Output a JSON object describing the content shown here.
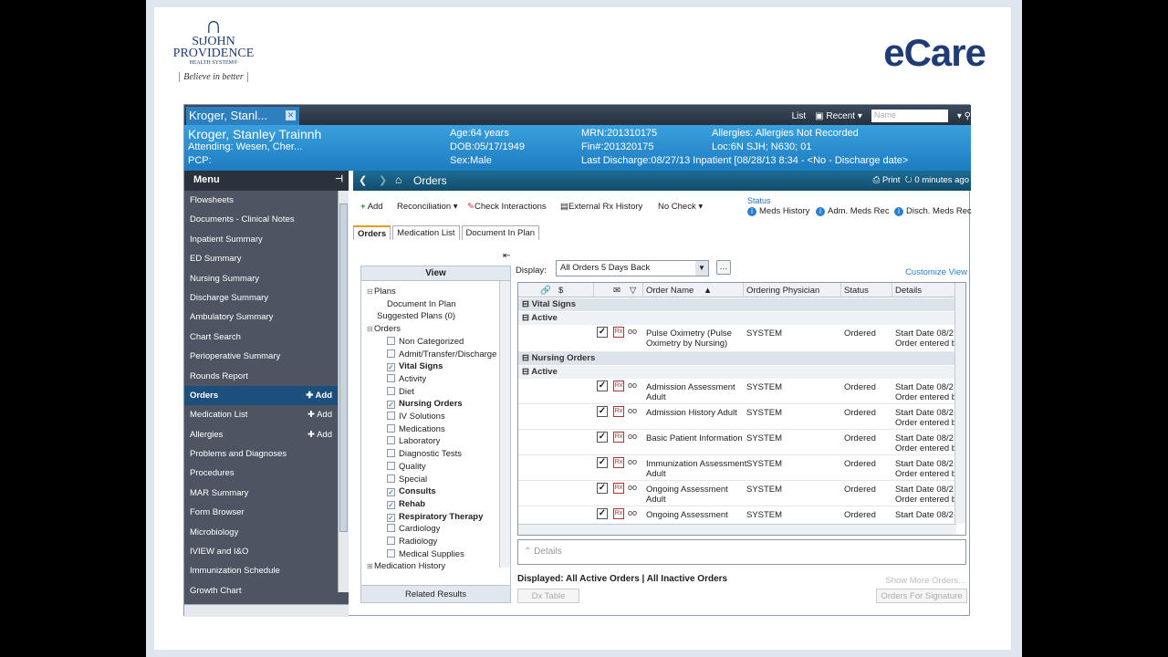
{
  "branding": {
    "logo_line1": "StJOHN",
    "logo_line2": "PROVIDENCE",
    "logo_line3": "HEALTH SYSTEM®",
    "tagline": "Believe in better",
    "product": "eCare"
  },
  "topbar": {
    "patient_tab": "Kroger, Stanl...",
    "list_label": "List",
    "recent_label": "Recent",
    "name_placeholder": "Name"
  },
  "banner": {
    "patient_name": "Kroger, Stanley Trainnh",
    "attending": "Attending: Wesen, Cher...",
    "pcp": "PCP:",
    "age": "Age:64 years",
    "dob": "DOB:05/17/1949",
    "sex": "Sex:Male",
    "mrn": "MRN:201310175",
    "fin": "Fin#:201320175",
    "last_discharge": "Last Discharge:08/27/13 Inpatient [08/28/13 8:34 - <No - Discharge date>",
    "allergies": "Allergies: Allergies Not Recorded",
    "location": "Loc:6N SJH; N630; 01"
  },
  "menu": {
    "title": "Menu",
    "items": [
      {
        "label": "Flowsheets",
        "add": ""
      },
      {
        "label": "Documents - Clinical Notes",
        "add": ""
      },
      {
        "label": "Inpatient Summary",
        "add": ""
      },
      {
        "label": "ED Summary",
        "add": ""
      },
      {
        "label": "Nursing Summary",
        "add": ""
      },
      {
        "label": "Discharge Summary",
        "add": ""
      },
      {
        "label": "Ambulatory Summary",
        "add": ""
      },
      {
        "label": "Chart Search",
        "add": ""
      },
      {
        "label": "Perioperative Summary",
        "add": ""
      },
      {
        "label": "Rounds Report",
        "add": ""
      },
      {
        "label": "Orders",
        "add": "Add"
      },
      {
        "label": "Medication List",
        "add": "Add"
      },
      {
        "label": "Allergies",
        "add": "Add"
      },
      {
        "label": "Problems and Diagnoses",
        "add": ""
      },
      {
        "label": "Procedures",
        "add": ""
      },
      {
        "label": "MAR Summary",
        "add": ""
      },
      {
        "label": "Form Browser",
        "add": ""
      },
      {
        "label": "Microbiology",
        "add": ""
      },
      {
        "label": "IVIEW and I&O",
        "add": ""
      },
      {
        "label": "Immunization Schedule",
        "add": ""
      },
      {
        "label": "Growth Chart",
        "add": ""
      }
    ]
  },
  "orders_header": {
    "title": "Orders",
    "print": "Print",
    "refresh": "0 minutes ago"
  },
  "toolbar": {
    "add": "Add",
    "reconciliation": "Reconciliation",
    "check_interactions": "Check Interactions",
    "external_rx": "External Rx History",
    "no_check": "No Check",
    "status_label": "Status",
    "meds_history": "Meds History",
    "adm_meds_rec": "Adm. Meds Rec",
    "disch_meds_rec": "Disch. Meds Rec"
  },
  "subtabs": [
    "Orders",
    "Medication List",
    "Document In Plan"
  ],
  "view": {
    "header": "View",
    "nodes": [
      {
        "text": "Plans",
        "kind": "exp",
        "indent": 0
      },
      {
        "text": "Document In Plan",
        "kind": "plain",
        "indent": 2
      },
      {
        "text": "Suggested Plans (0)",
        "kind": "plain",
        "indent": 1
      },
      {
        "text": "Orders",
        "kind": "exp",
        "indent": 0
      },
      {
        "text": "Non Categorized",
        "kind": "cb",
        "indent": 2
      },
      {
        "text": "Admit/Transfer/Discharge",
        "kind": "cb",
        "indent": 2
      },
      {
        "text": "Vital Signs",
        "kind": "cbx",
        "indent": 2
      },
      {
        "text": "Activity",
        "kind": "cb",
        "indent": 2
      },
      {
        "text": "Diet",
        "kind": "cb",
        "indent": 2
      },
      {
        "text": "Nursing Orders",
        "kind": "cbx",
        "indent": 2
      },
      {
        "text": "IV Solutions",
        "kind": "cb",
        "indent": 2
      },
      {
        "text": "Medications",
        "kind": "cb",
        "indent": 2
      },
      {
        "text": "Laboratory",
        "kind": "cb",
        "indent": 2
      },
      {
        "text": "Diagnostic Tests",
        "kind": "cb",
        "indent": 2
      },
      {
        "text": "Quality",
        "kind": "cb",
        "indent": 2
      },
      {
        "text": "Special",
        "kind": "cb",
        "indent": 2
      },
      {
        "text": "Consults",
        "kind": "cbx",
        "indent": 2
      },
      {
        "text": "Rehab",
        "kind": "cbx",
        "indent": 2
      },
      {
        "text": "Respiratory Therapy",
        "kind": "cbx",
        "indent": 2
      },
      {
        "text": "Cardiology",
        "kind": "cb",
        "indent": 2
      },
      {
        "text": "Radiology",
        "kind": "cb",
        "indent": 2
      },
      {
        "text": "Medical Supplies",
        "kind": "cb",
        "indent": 2
      },
      {
        "text": "Medication History",
        "kind": "exp2",
        "indent": 0
      }
    ],
    "related_results": "Related Results"
  },
  "display": {
    "label": "Display:",
    "value": "All Orders 5 Days Back",
    "customize": "Customize View"
  },
  "grid": {
    "columns": {
      "dollar": "$",
      "order_name": "Order Name",
      "physician": "Ordering Physician",
      "status": "Status",
      "details": "Details"
    },
    "rows": [
      {
        "type": "group",
        "text": "Vital Signs"
      },
      {
        "type": "sub",
        "text": "Active"
      },
      {
        "type": "order",
        "name1": "Pulse Oximetry (Pulse",
        "name2": "Oximetry by Nursing)",
        "phys": "SYSTEM",
        "status": "Ordered",
        "det1": "Start Date 08/2",
        "det2": "Order entered b",
        "h": 30
      },
      {
        "type": "group",
        "text": "Nursing Orders"
      },
      {
        "type": "sub",
        "text": "Active"
      },
      {
        "type": "order",
        "name1": "Admission Assessment",
        "name2": "Adult",
        "phys": "SYSTEM",
        "status": "Ordered",
        "det1": "Start Date 08/2",
        "det2": "Order entered b",
        "h": 28
      },
      {
        "type": "order",
        "name1": "Admission History Adult",
        "name2": "",
        "phys": "SYSTEM",
        "status": "Ordered",
        "det1": "Start Date 08/2",
        "det2": "Order entered b",
        "h": 28
      },
      {
        "type": "order",
        "name1": "Basic Patient Information",
        "name2": "",
        "phys": "SYSTEM",
        "status": "Ordered",
        "det1": "Start Date 08/2",
        "det2": "Order entered b",
        "h": 28
      },
      {
        "type": "order",
        "name1": "Immunization Assessment",
        "name2": "Adult",
        "phys": "SYSTEM",
        "status": "Ordered",
        "det1": "Start Date 08/2",
        "det2": "Order entered b",
        "h": 28
      },
      {
        "type": "order",
        "name1": "Ongoing Assessment",
        "name2": "Adult",
        "phys": "SYSTEM",
        "status": "Ordered",
        "det1": "Start Date 08/2",
        "det2": "Order entered b",
        "h": 28
      },
      {
        "type": "order",
        "name1": "Ongoing Assessment",
        "name2": "",
        "phys": "SYSTEM",
        "status": "Ordered",
        "det1": "Start Date 08/2",
        "det2": "",
        "h": 28
      }
    ]
  },
  "details_label": "Details",
  "footer": {
    "displayed": "Displayed: All Active Orders  |  All Inactive Orders",
    "show_more": "Show More Orders...",
    "dx_table": "Dx Table",
    "orders_for_signature": "Orders For Signature"
  }
}
